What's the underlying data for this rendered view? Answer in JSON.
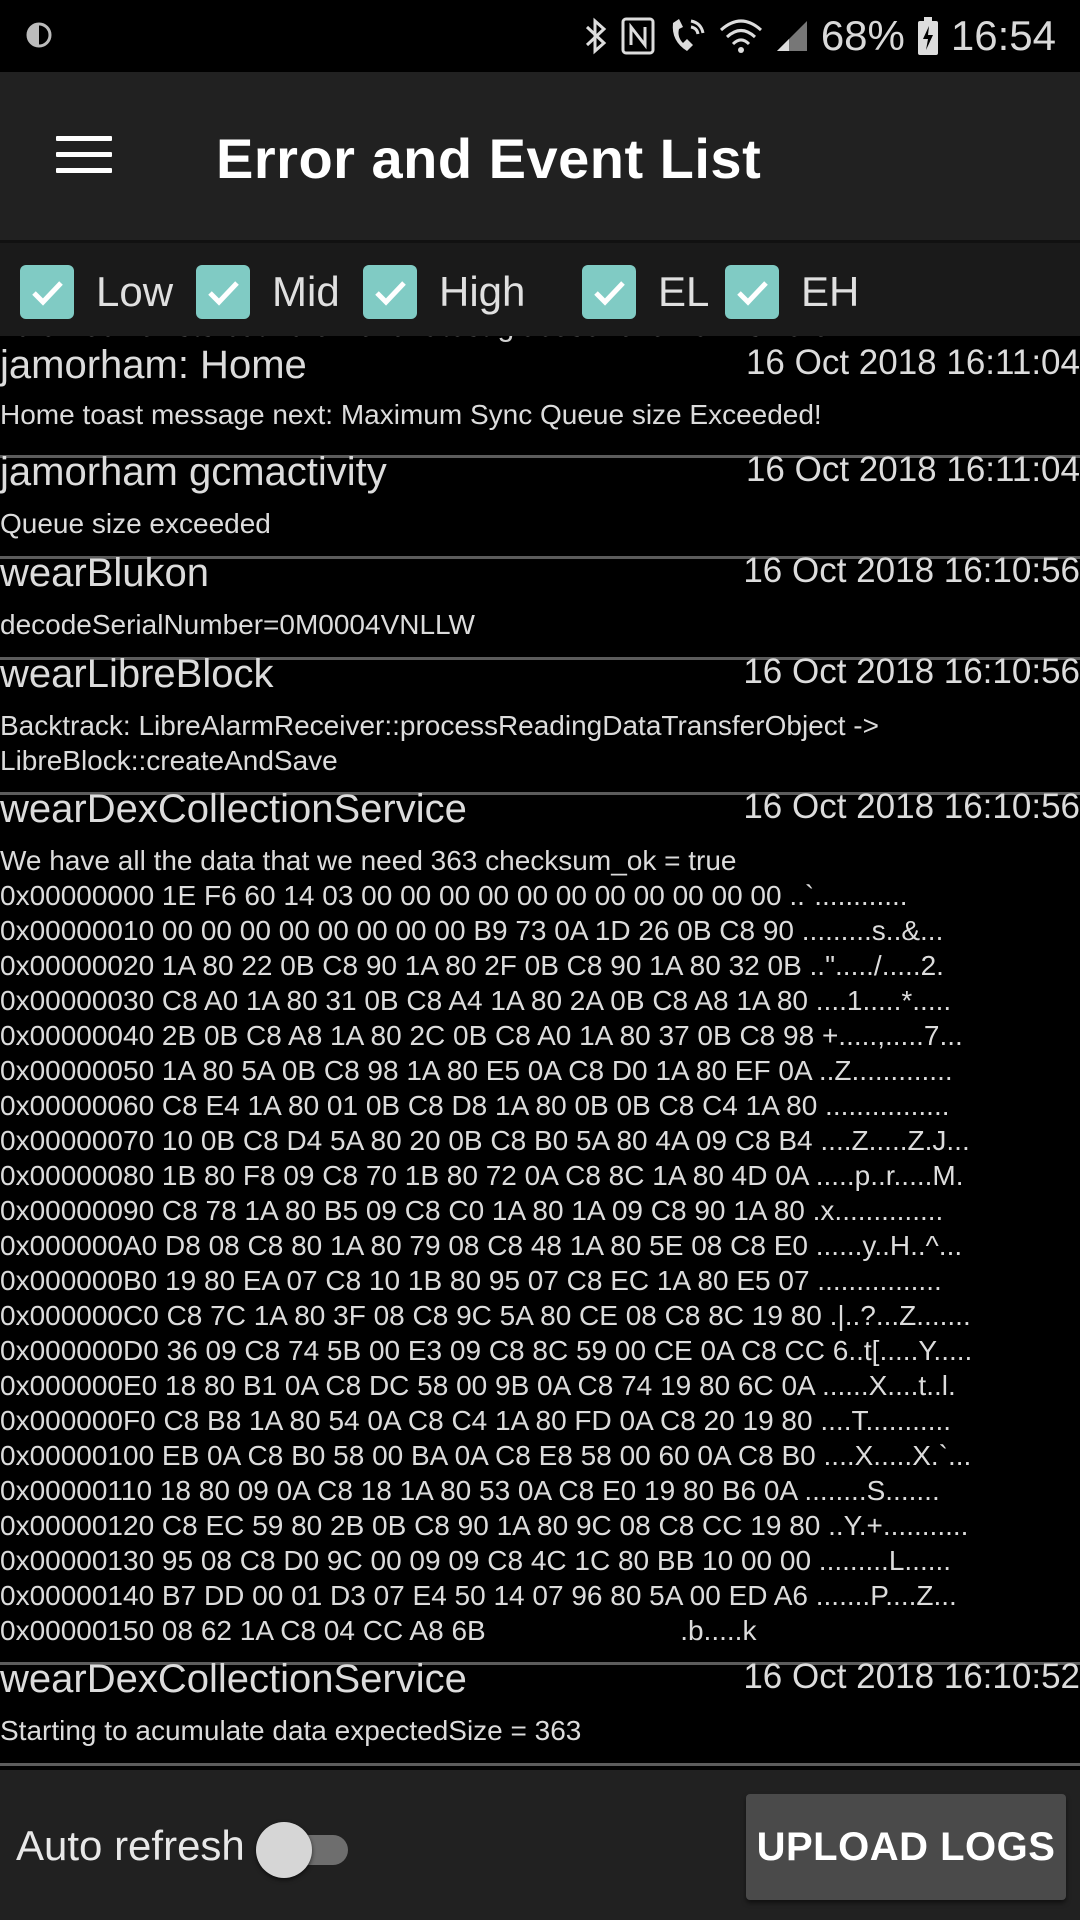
{
  "status_bar": {
    "battery": "68%",
    "time": "16:54"
  },
  "app_bar": {
    "title": "Error and Event List"
  },
  "filters": [
    {
      "label": "Low",
      "checked": true
    },
    {
      "label": "Mid",
      "checked": true
    },
    {
      "label": "High",
      "checked": true
    },
    {
      "label": "EL",
      "checked": true
    },
    {
      "label": "EH",
      "checked": true
    }
  ],
  "log": {
    "clipped_text": "libreBlock exists but libreTrendLatest.glucoseLevelRaw is zero",
    "entries": [
      {
        "title": "jamorham: Home",
        "time": "16 Oct 2018 16:11:04",
        "message": "Home toast message next: Maximum Sync Queue size Exceeded!"
      },
      {
        "title": "jamorham gcmactivity",
        "time": "16 Oct 2018 16:11:04",
        "message": "Queue size exceeded"
      },
      {
        "title": "wearBlukon",
        "time": "16 Oct 2018 16:10:56",
        "message": "decodeSerialNumber=0M0004VNLLW"
      },
      {
        "title": "wearLibreBlock",
        "time": "16 Oct 2018 16:10:56",
        "message": "Backtrack: LibreAlarmReceiver::processReadingDataTransferObject ->\nLibreBlock::createAndSave"
      },
      {
        "title": "wearDexCollectionService",
        "time": "16 Oct 2018 16:10:56",
        "message": "We have all the data that we need 363 checksum_ok = true\n0x00000000 1E F6 60 14 03 00 00 00 00 00 00 00 00 00 00 00 ..`............\n0x00000010 00 00 00 00 00 00 00 00 B9 73 0A 1D 26 0B C8 90 .........s..&...\n0x00000020 1A 80 22 0B C8 90 1A 80 2F 0B C8 90 1A 80 32 0B ..\"...../.....2.\n0x00000030 C8 A0 1A 80 31 0B C8 A4 1A 80 2A 0B C8 A8 1A 80 ....1.....*.....\n0x00000040 2B 0B C8 A8 1A 80 2C 0B C8 A0 1A 80 37 0B C8 98 +.....,.....7...\n0x00000050 1A 80 5A 0B C8 98 1A 80 E5 0A C8 D0 1A 80 EF 0A ..Z.............\n0x00000060 C8 E4 1A 80 01 0B C8 D8 1A 80 0B 0B C8 C4 1A 80 ................\n0x00000070 10 0B C8 D4 5A 80 20 0B C8 B0 5A 80 4A 09 C8 B4 ....Z.....Z.J...\n0x00000080 1B 80 F8 09 C8 70 1B 80 72 0A C8 8C 1A 80 4D 0A .....p..r.....M.\n0x00000090 C8 78 1A 80 B5 09 C8 C0 1A 80 1A 09 C8 90 1A 80 .x..............\n0x000000A0 D8 08 C8 80 1A 80 79 08 C8 48 1A 80 5E 08 C8 E0 ......y..H..^...\n0x000000B0 19 80 EA 07 C8 10 1B 80 95 07 C8 EC 1A 80 E5 07 ................\n0x000000C0 C8 7C 1A 80 3F 08 C8 9C 5A 80 CE 08 C8 8C 19 80 .|..?...Z.......\n0x000000D0 36 09 C8 74 5B 00 E3 09 C8 8C 59 00 CE 0A C8 CC 6..t[.....Y.....\n0x000000E0 18 80 B1 0A C8 DC 58 00 9B 0A C8 74 19 80 6C 0A ......X....t..l.\n0x000000F0 C8 B8 1A 80 54 0A C8 C4 1A 80 FD 0A C8 20 19 80 ....T...........\n0x00000100 EB 0A C8 B0 58 00 BA 0A C8 E8 58 00 60 0A C8 B0 ....X.....X.`...\n0x00000110 18 80 09 0A C8 18 1A 80 53 0A C8 E0 19 80 B6 0A ........S.......\n0x00000120 C8 EC 59 80 2B 0B C8 90 1A 80 9C 08 C8 CC 19 80 ..Y.+...........\n0x00000130 95 08 C8 D0 9C 00 09 09 C8 4C 1C 80 BB 10 00 00 .........L......\n0x00000140 B7 DD 00 01 D3 07 E4 50 14 07 96 80 5A 00 ED A6 .......P....Z...\n0x00000150 08 62 1A C8 04 CC A8 6B                         .b.....k"
      },
      {
        "title": "wearDexCollectionService",
        "time": "16 Oct 2018 16:10:52",
        "message": "Starting to acumulate data expectedSize = 363"
      }
    ]
  },
  "bottom_bar": {
    "auto_refresh_label": "Auto refresh",
    "auto_refresh_on": false,
    "upload_label": "UPLOAD LOGS"
  }
}
